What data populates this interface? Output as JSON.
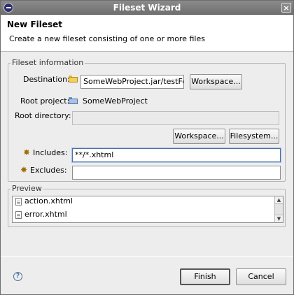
{
  "window": {
    "title": "Fileset Wizard",
    "close_glyph": "×"
  },
  "banner": {
    "title": "New Fileset",
    "description": "Create a new fileset consisting of one or more files"
  },
  "fileset_info": {
    "legend": "Fileset information",
    "destination_label": "Destination:",
    "destination_value": "SomeWebProject.jar/testFolder",
    "destination_workspace_button": "Workspace...",
    "root_project_label": "Root project:",
    "root_project_value": "SomeWebProject",
    "root_directory_label": "Root directory:",
    "root_directory_value": "",
    "workspace_button": "Workspace...",
    "filesystem_button": "Filesystem...",
    "includes_label": "Includes:",
    "includes_value": "**/*.xhtml",
    "excludes_label": "Excludes:",
    "excludes_value": ""
  },
  "preview": {
    "legend": "Preview",
    "items": [
      "action.xhtml",
      "error.xhtml"
    ],
    "scroll_up_glyph": "▲",
    "scroll_down_glyph": "▼"
  },
  "footer": {
    "help_glyph": "?",
    "finish_button": "Finish",
    "cancel_button": "Cancel"
  },
  "icons": {
    "app": "eclipse-icon",
    "folder": "folder-icon",
    "project": "project-folder-icon",
    "includes": "pattern-add-icon",
    "excludes": "pattern-remove-icon",
    "file": "file-icon",
    "help": "help-icon"
  }
}
